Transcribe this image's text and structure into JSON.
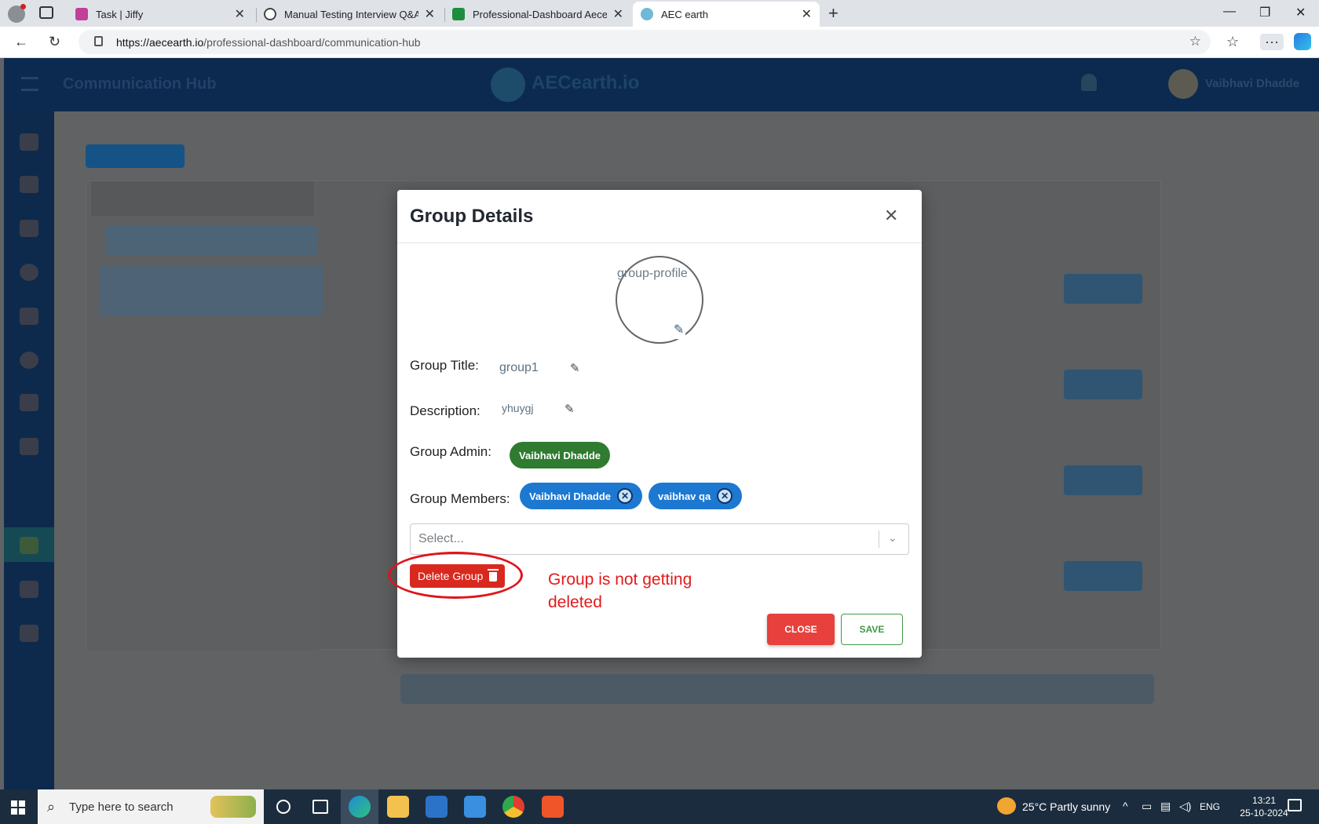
{
  "browser": {
    "tabs": [
      {
        "label": "Task | Jiffy",
        "favicon_color": "#c2409a",
        "active": false
      },
      {
        "label": "Manual Testing Interview Q&A",
        "favicon_color": "#444444",
        "active": false
      },
      {
        "label": "Professional-Dashboard Aecearth",
        "favicon_color": "#1e8e3e",
        "active": false
      },
      {
        "label": "AEC earth",
        "favicon_color": "#6fb8d8",
        "active": true
      }
    ],
    "url_host": "https://aecearth.io",
    "url_path": "/professional-dashboard/communication-hub"
  },
  "app": {
    "header_title": "Communication Hub",
    "logo_text": "AECearth.io",
    "user_name": "Vaibhavi Dhadde"
  },
  "modal": {
    "title": "Group Details",
    "profile_alt": "group-profile",
    "group_title_label": "Group Title:",
    "group_title_value": "group1",
    "description_label": "Description:",
    "description_value": "yhuygj",
    "group_admin_label": "Group Admin:",
    "group_admin": "Vaibhavi Dhadde",
    "group_members_label": "Group Members:",
    "members": [
      "Vaibhavi Dhadde",
      "vaibhav qa"
    ],
    "select_placeholder": "Select...",
    "delete_label": "Delete Group",
    "close_label": "CLOSE",
    "save_label": "SAVE"
  },
  "annotation": {
    "text": "Group is not getting deleted",
    "color": "#e21b1b"
  },
  "taskbar": {
    "search_placeholder": "Type here to search",
    "weather": "25°C  Partly sunny",
    "language": "ENG",
    "time": "13:21",
    "date": "25-10-2024"
  }
}
